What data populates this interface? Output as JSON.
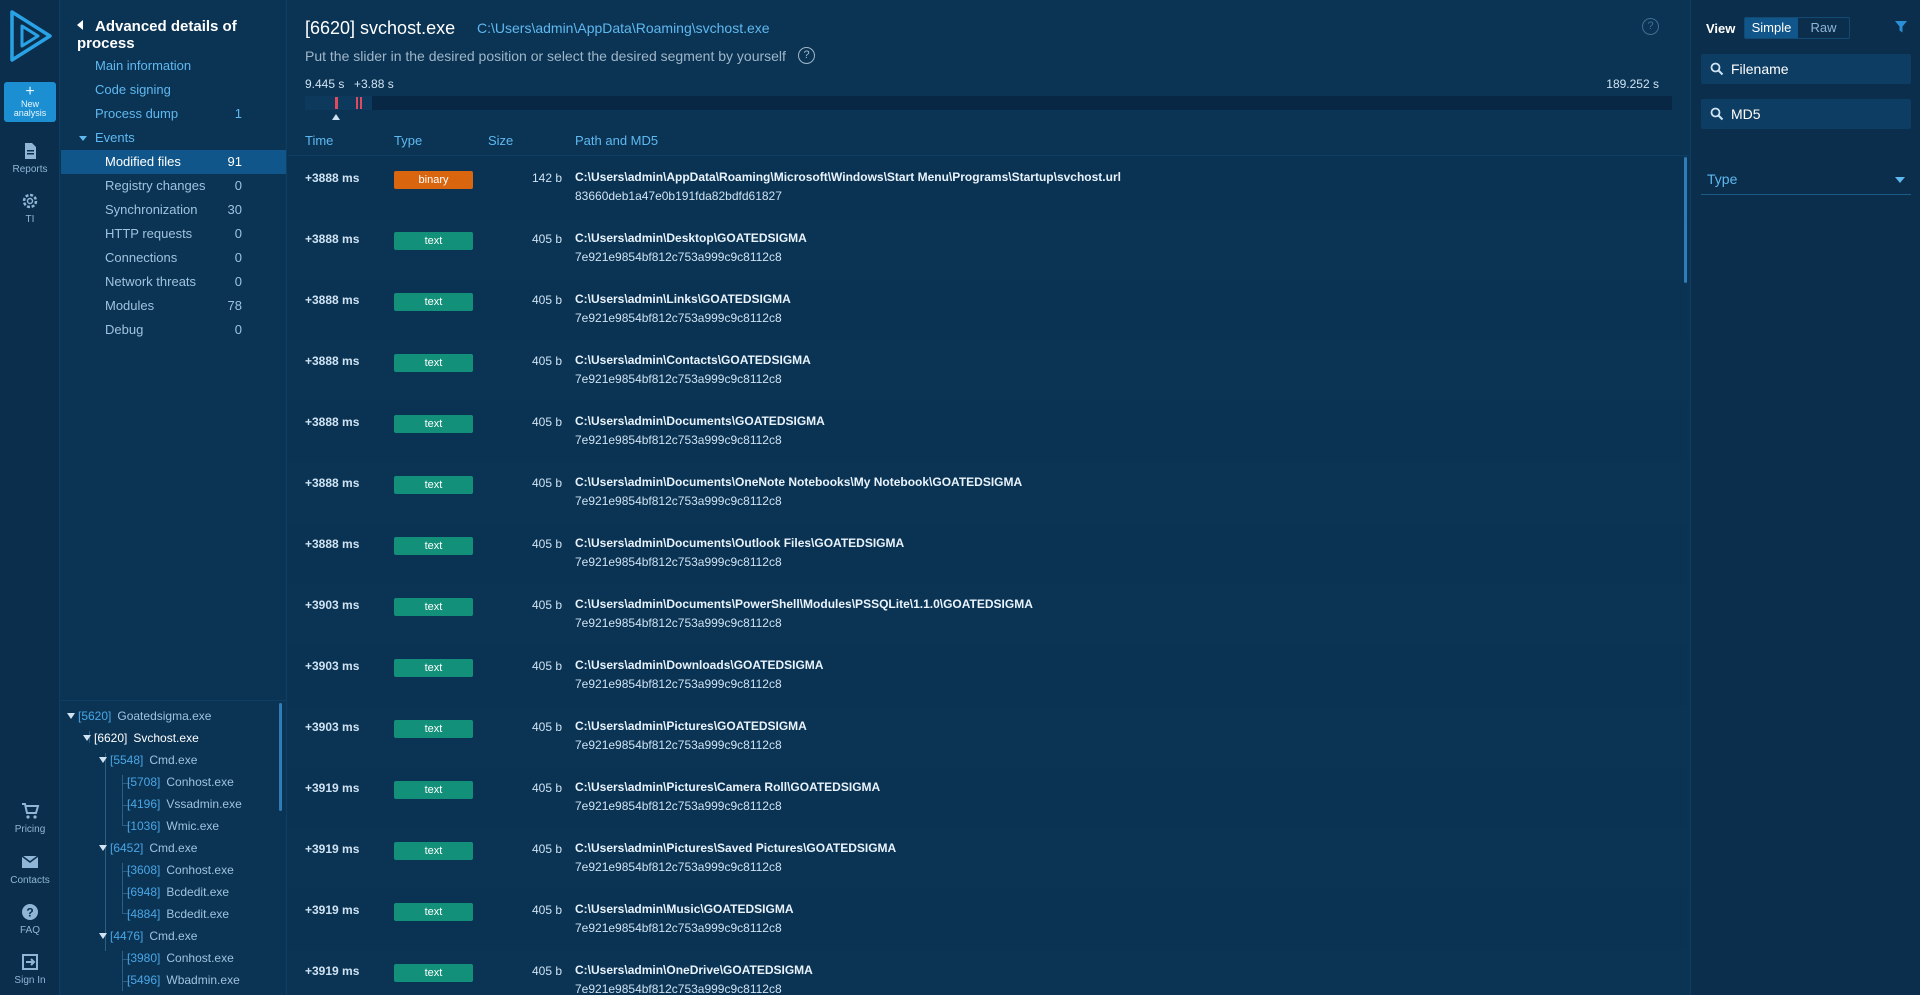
{
  "rail": {
    "new_analysis": "New analysis",
    "reports": "Reports",
    "ti": "TI",
    "pricing": "Pricing",
    "contacts": "Contacts",
    "faq": "FAQ",
    "sign_in": "Sign In"
  },
  "nav": {
    "title": "Advanced details of process",
    "main_information": "Main information",
    "code_signing": "Code signing",
    "process_dump": "Process dump",
    "process_dump_count": "1",
    "events": "Events",
    "items": [
      {
        "label": "Modified files",
        "count": "91"
      },
      {
        "label": "Registry changes",
        "count": "0"
      },
      {
        "label": "Synchronization",
        "count": "30"
      },
      {
        "label": "HTTP requests",
        "count": "0"
      },
      {
        "label": "Connections",
        "count": "0"
      },
      {
        "label": "Network threats",
        "count": "0"
      },
      {
        "label": "Modules",
        "count": "78"
      },
      {
        "label": "Debug",
        "count": "0"
      }
    ]
  },
  "tree": [
    {
      "pid": "[5620]",
      "name": "Goatedsigma.exe"
    },
    {
      "pid": "[6620]",
      "name": "Svchost.exe"
    },
    {
      "pid": "[5548]",
      "name": "Cmd.exe"
    },
    {
      "pid": "[5708]",
      "name": "Conhost.exe"
    },
    {
      "pid": "[4196]",
      "name": "Vssadmin.exe"
    },
    {
      "pid": "[1036]",
      "name": "Wmic.exe"
    },
    {
      "pid": "[6452]",
      "name": "Cmd.exe"
    },
    {
      "pid": "[3608]",
      "name": "Conhost.exe"
    },
    {
      "pid": "[6948]",
      "name": "Bcdedit.exe"
    },
    {
      "pid": "[4884]",
      "name": "Bcdedit.exe"
    },
    {
      "pid": "[4476]",
      "name": "Cmd.exe"
    },
    {
      "pid": "[3980]",
      "name": "Conhost.exe"
    },
    {
      "pid": "[5496]",
      "name": "Wbadmin.exe"
    }
  ],
  "header": {
    "process_title": "[6620] svchost.exe",
    "process_path": "C:\\Users\\admin\\AppData\\Roaming\\svchost.exe",
    "slider_hint": "Put the slider in the desired position or select the desired segment by yourself",
    "timeline_start": "9.445 s",
    "timeline_offset": "+3.88 s",
    "timeline_end": "189.252 s"
  },
  "table": {
    "columns": {
      "time": "Time",
      "type": "Type",
      "size": "Size",
      "path": "Path and MD5"
    },
    "rows": [
      {
        "time": "+3888 ms",
        "type": "binary",
        "size": "142 b",
        "path": "C:\\Users\\admin\\AppData\\Roaming\\Microsoft\\Windows\\Start Menu\\Programs\\Startup\\svchost.url",
        "md5": "83660deb1a47e0b191fda82bdfd61827"
      },
      {
        "time": "+3888 ms",
        "type": "text",
        "size": "405 b",
        "path": "C:\\Users\\admin\\Desktop\\GOATEDSIGMA",
        "md5": "7e921e9854bf812c753a999c9c8112c8"
      },
      {
        "time": "+3888 ms",
        "type": "text",
        "size": "405 b",
        "path": "C:\\Users\\admin\\Links\\GOATEDSIGMA",
        "md5": "7e921e9854bf812c753a999c9c8112c8"
      },
      {
        "time": "+3888 ms",
        "type": "text",
        "size": "405 b",
        "path": "C:\\Users\\admin\\Contacts\\GOATEDSIGMA",
        "md5": "7e921e9854bf812c753a999c9c8112c8"
      },
      {
        "time": "+3888 ms",
        "type": "text",
        "size": "405 b",
        "path": "C:\\Users\\admin\\Documents\\GOATEDSIGMA",
        "md5": "7e921e9854bf812c753a999c9c8112c8"
      },
      {
        "time": "+3888 ms",
        "type": "text",
        "size": "405 b",
        "path": "C:\\Users\\admin\\Documents\\OneNote Notebooks\\My Notebook\\GOATEDSIGMA",
        "md5": "7e921e9854bf812c753a999c9c8112c8"
      },
      {
        "time": "+3888 ms",
        "type": "text",
        "size": "405 b",
        "path": "C:\\Users\\admin\\Documents\\Outlook Files\\GOATEDSIGMA",
        "md5": "7e921e9854bf812c753a999c9c8112c8"
      },
      {
        "time": "+3903 ms",
        "type": "text",
        "size": "405 b",
        "path": "C:\\Users\\admin\\Documents\\PowerShell\\Modules\\PSSQLite\\1.1.0\\GOATEDSIGMA",
        "md5": "7e921e9854bf812c753a999c9c8112c8"
      },
      {
        "time": "+3903 ms",
        "type": "text",
        "size": "405 b",
        "path": "C:\\Users\\admin\\Downloads\\GOATEDSIGMA",
        "md5": "7e921e9854bf812c753a999c9c8112c8"
      },
      {
        "time": "+3903 ms",
        "type": "text",
        "size": "405 b",
        "path": "C:\\Users\\admin\\Pictures\\GOATEDSIGMA",
        "md5": "7e921e9854bf812c753a999c9c8112c8"
      },
      {
        "time": "+3919 ms",
        "type": "text",
        "size": "405 b",
        "path": "C:\\Users\\admin\\Pictures\\Camera Roll\\GOATEDSIGMA",
        "md5": "7e921e9854bf812c753a999c9c8112c8"
      },
      {
        "time": "+3919 ms",
        "type": "text",
        "size": "405 b",
        "path": "C:\\Users\\admin\\Pictures\\Saved Pictures\\GOATEDSIGMA",
        "md5": "7e921e9854bf812c753a999c9c8112c8"
      },
      {
        "time": "+3919 ms",
        "type": "text",
        "size": "405 b",
        "path": "C:\\Users\\admin\\Music\\GOATEDSIGMA",
        "md5": "7e921e9854bf812c753a999c9c8112c8"
      },
      {
        "time": "+3919 ms",
        "type": "text",
        "size": "405 b",
        "path": "C:\\Users\\admin\\OneDrive\\GOATEDSIGMA",
        "md5": "7e921e9854bf812c753a999c9c8112c8"
      }
    ]
  },
  "filters": {
    "view_label": "View",
    "simple": "Simple",
    "raw": "Raw",
    "filename_placeholder": "Filename",
    "md5_placeholder": "MD5",
    "type_label": "Type"
  },
  "colors": {
    "binary_badge": "#d9660f",
    "text_badge": "#13907a",
    "accent": "#5fb8f0",
    "timeline_marker": "#e04a5f"
  }
}
